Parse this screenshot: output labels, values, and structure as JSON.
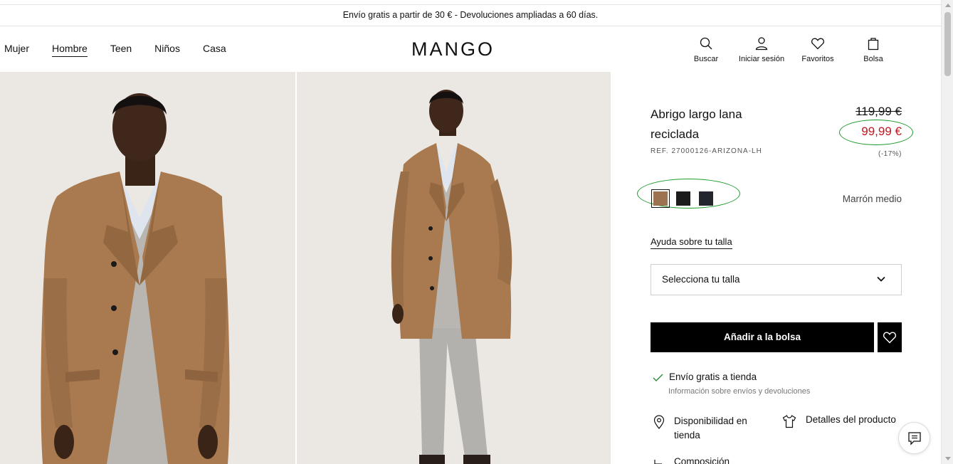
{
  "announcement": "Envío gratis a partir de 30 € - Devoluciones ampliadas a 60 días.",
  "nav": {
    "items": [
      {
        "label": "Mujer",
        "active": false
      },
      {
        "label": "Hombre",
        "active": true
      },
      {
        "label": "Teen",
        "active": false
      },
      {
        "label": "Niños",
        "active": false
      },
      {
        "label": "Casa",
        "active": false
      }
    ]
  },
  "logo": "MANGO",
  "actions": {
    "search": {
      "label": "Buscar",
      "icon": "search-icon"
    },
    "login": {
      "label": "Iniciar sesión",
      "icon": "user-icon"
    },
    "favorites": {
      "label": "Favoritos",
      "icon": "heart-icon"
    },
    "bag": {
      "label": "Bolsa",
      "icon": "bag-icon"
    }
  },
  "product": {
    "title": "Abrigo largo lana reciclada",
    "ref": "REF. 27000126-ARIZONA-LH",
    "old_price": "119,99 €",
    "new_price": "99,99 €",
    "discount": "(-17%)",
    "colors": [
      {
        "hex": "#9c7250",
        "selected": true
      },
      {
        "hex": "#1c1c1c",
        "selected": false
      },
      {
        "hex": "#23272d",
        "selected": false
      }
    ],
    "color_name": "Marrón medio",
    "size_help": "Ayuda sobre tu talla",
    "size_select": "Selecciona tu talla",
    "add_to_bag": "Añadir a la bolsa",
    "shipping": "Envío gratis a tienda",
    "shipping_info": "Información sobre envíos y devoluciones",
    "availability": "Disponibilidad en tienda",
    "details": "Detalles del producto",
    "composition": "Composición"
  },
  "colors": {
    "accent_red": "#c4161c",
    "annotation_green": "#1f9a2c"
  }
}
